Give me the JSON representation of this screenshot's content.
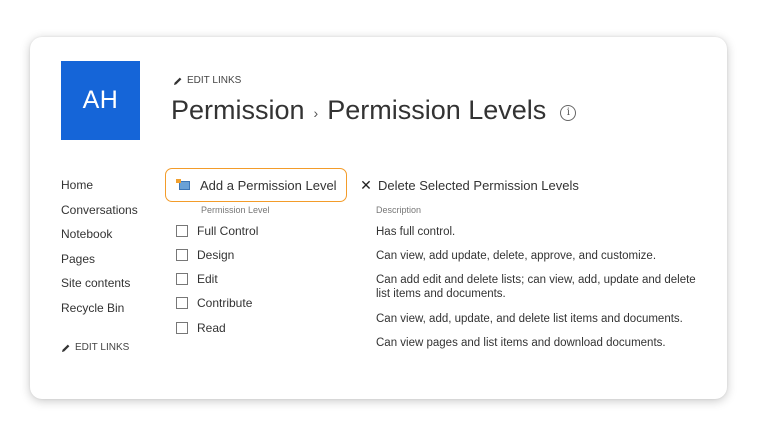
{
  "site": {
    "logo_initials": "AH",
    "logo_color": "#1565d8"
  },
  "header": {
    "edit_links": "EDIT LINKS",
    "title_parent": "Permission",
    "title_separator": "›",
    "title_current": "Permission Levels",
    "info_icon": "ⓘ"
  },
  "left_nav": {
    "items": [
      {
        "label": "Home"
      },
      {
        "label": "Conversations"
      },
      {
        "label": "Notebook"
      },
      {
        "label": "Pages"
      },
      {
        "label": "Site contents"
      },
      {
        "label": "Recycle Bin"
      }
    ],
    "edit_links": "EDIT LINKS"
  },
  "toolbar": {
    "add_label": "Add a Permission Level",
    "delete_label": "Delete Selected Permission Levels",
    "highlight_color": "#f39c2a"
  },
  "table": {
    "headers": {
      "permission_level": "Permission Level",
      "description": "Description"
    },
    "rows": [
      {
        "name": "Full Control",
        "checked": false
      },
      {
        "name": "Design",
        "checked": false
      },
      {
        "name": "Edit",
        "checked": false
      },
      {
        "name": "Contribute",
        "checked": false
      },
      {
        "name": "Read",
        "checked": false
      }
    ],
    "descriptions": [
      "Has full control.",
      "Can view, add update, delete, approve, and customize.",
      "Can add edit and delete lists; can view, add, update and delete list items and documents.",
      "Can view, add, update, and delete list items and documents.",
      "Can view pages and list items and download documents."
    ]
  }
}
